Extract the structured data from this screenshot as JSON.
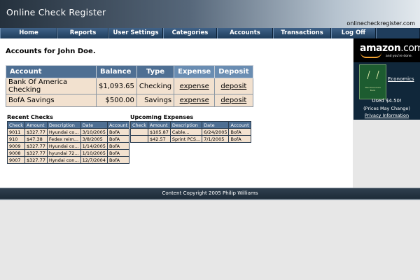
{
  "header": {
    "title": "Online Check Register",
    "url": "onlinecheckregister.com"
  },
  "nav": {
    "items": [
      "Home",
      "Reports",
      "User Settings",
      "Categories",
      "Accounts",
      "Transactions",
      "Log Off"
    ]
  },
  "accounts": {
    "heading": "Accounts for John Doe.",
    "columns": [
      "Account",
      "Balance",
      "Type",
      "Expense",
      "Deposit"
    ],
    "rows": [
      {
        "account": "Bank Of America Checking",
        "balance": "$1,093.65",
        "type": "Checking",
        "expense": "expense",
        "deposit": "deposit"
      },
      {
        "account": "BofA Savings",
        "balance": "$500.00",
        "type": "Savings",
        "expense": "expense",
        "deposit": "deposit"
      }
    ]
  },
  "recent_checks": {
    "heading": "Recent Checks",
    "columns": [
      "Check",
      "Amount",
      "Description",
      "Date",
      "Account"
    ],
    "rows": [
      [
        "9011",
        "$327.77",
        "Hyundai co...",
        "3/10/2005",
        "BofA"
      ],
      [
        "910",
        "$47.38",
        "Fedex reim...",
        "3/8/2005",
        "BofA"
      ],
      [
        "9009",
        "$327.77",
        "Hyundai co...",
        "1/14/2005",
        "BofA"
      ],
      [
        "9008",
        "$327.77",
        "hyundai 72...",
        "1/10/2005",
        "BofA"
      ],
      [
        "9007",
        "$327.77",
        "Hyndai con...",
        "12/7/2004",
        "BofA"
      ]
    ]
  },
  "upcoming_expenses": {
    "heading": "Upcoming Expenses",
    "columns": [
      "Check",
      "Amount",
      "Description",
      "Date",
      "Account"
    ],
    "rows": [
      [
        "",
        "$105.87",
        "Cable...",
        "6/24/2005",
        "BofA"
      ],
      [
        "",
        "$42.57",
        "Sprint PCS...",
        "7/1/2005",
        "BofA"
      ]
    ]
  },
  "ad": {
    "logo_word": "amazon",
    "logo_suffix": ".com",
    "tagline": "and you're done.",
    "book_title": "The Economics Book",
    "book_link": "Economics",
    "price": "Used $4.50!",
    "note": "(Prices May Change)",
    "privacy": "Privacy Information"
  },
  "footer": {
    "text": "Content Copyright 2005 Philip Williams"
  },
  "colors": {
    "nav_bg": "#24405d",
    "table_header": "#4e6f93",
    "row_bg": "#f2e1cf"
  }
}
